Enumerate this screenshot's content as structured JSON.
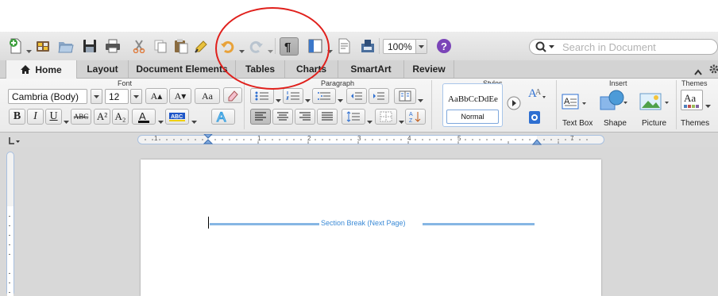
{
  "toolbar": {
    "zoom": "100%",
    "search_placeholder": "Search in Document",
    "icons": [
      "new-document-icon",
      "gallery-icon",
      "open-icon",
      "save-icon",
      "print-icon",
      "cut-icon",
      "copy-icon",
      "paste-icon",
      "format-painter-icon",
      "undo-icon",
      "redo-icon",
      "show-formatting-icon",
      "sidebar-icon",
      "text-box-icon",
      "page-layout-icon",
      "help-icon",
      "search-icon"
    ]
  },
  "tabs": [
    {
      "label": "Home",
      "active": true
    },
    {
      "label": "Layout"
    },
    {
      "label": "Document Elements"
    },
    {
      "label": "Tables"
    },
    {
      "label": "Charts"
    },
    {
      "label": "SmartArt"
    },
    {
      "label": "Review"
    }
  ],
  "ribbon": {
    "groups": {
      "font": "Font",
      "paragraph": "Paragraph",
      "styles": "Styles",
      "insert": "Insert",
      "themes": "Themes"
    },
    "font_name": "Cambria (Body)",
    "font_size": "12",
    "style_sample": "AaBbCcDdEe",
    "style_name": "Normal",
    "buttons": {
      "grow_font": "A▴",
      "shrink_font": "A▾",
      "change_case": "Aa",
      "bold": "B",
      "italic": "I",
      "underline": "U",
      "strikethrough": "ABC",
      "superscript": "A²",
      "subscript": "A₂",
      "theme_sample": "Aa"
    },
    "insert": {
      "text_box": "Text Box",
      "shape": "Shape",
      "picture": "Picture",
      "themes": "Themes"
    }
  },
  "ruler": {
    "numbers": [
      "1",
      "1",
      "2",
      "3",
      "4",
      "5",
      "7"
    ]
  },
  "document": {
    "section_break": "Section Break (Next Page)"
  },
  "colors": {
    "annotation": "#e0201c",
    "section_break": "#3a8ad6",
    "accent": "#2e6fd1"
  }
}
